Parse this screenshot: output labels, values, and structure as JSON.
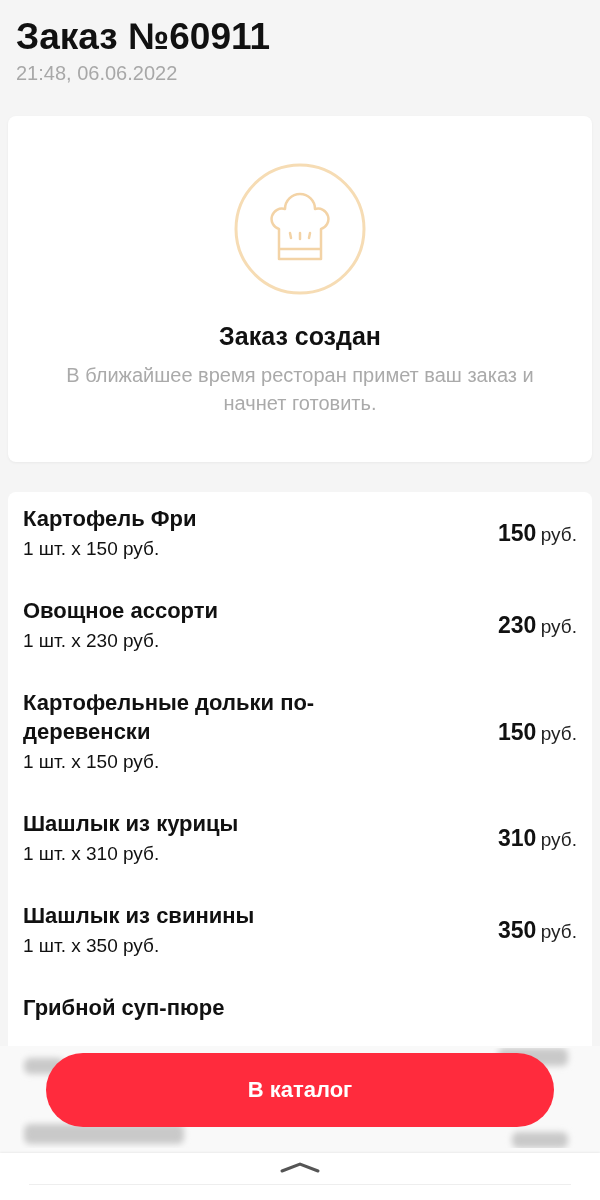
{
  "header": {
    "title": "Заказ №60911",
    "date": "21:48, 06.06.2022"
  },
  "status": {
    "title": "Заказ создан",
    "description": "В ближайшее время ресторан примет ваш заказ и начнет готовить."
  },
  "items": [
    {
      "name": "Картофель Фри",
      "quantity": "1 шт. x 150 руб.",
      "price": "150",
      "currency": "руб."
    },
    {
      "name": "Овощное ассорти",
      "quantity": "1 шт. x 230 руб.",
      "price": "230",
      "currency": "руб."
    },
    {
      "name": "Картофельные дольки по-деревенски",
      "quantity": "1 шт. x 150 руб.",
      "price": "150",
      "currency": "руб."
    },
    {
      "name": "Шашлык из курицы",
      "quantity": "1 шт. x 310 руб.",
      "price": "310",
      "currency": "руб."
    },
    {
      "name": "Шашлык из свинины",
      "quantity": "1 шт. x 350 руб.",
      "price": "350",
      "currency": "руб."
    },
    {
      "name": "Грибной суп-пюре"
    }
  ],
  "catalog_button": {
    "label": "В каталог"
  }
}
